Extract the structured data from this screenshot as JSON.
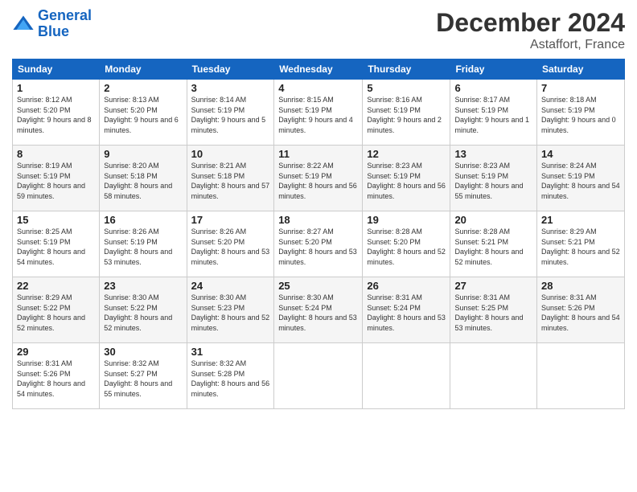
{
  "logo": {
    "line1": "General",
    "line2": "Blue"
  },
  "title": "December 2024",
  "subtitle": "Astaffort, France",
  "headers": [
    "Sunday",
    "Monday",
    "Tuesday",
    "Wednesday",
    "Thursday",
    "Friday",
    "Saturday"
  ],
  "weeks": [
    [
      {
        "day": "1",
        "sunrise": "8:12 AM",
        "sunset": "5:20 PM",
        "daylight": "9 hours and 8 minutes."
      },
      {
        "day": "2",
        "sunrise": "8:13 AM",
        "sunset": "5:20 PM",
        "daylight": "9 hours and 6 minutes."
      },
      {
        "day": "3",
        "sunrise": "8:14 AM",
        "sunset": "5:19 PM",
        "daylight": "9 hours and 5 minutes."
      },
      {
        "day": "4",
        "sunrise": "8:15 AM",
        "sunset": "5:19 PM",
        "daylight": "9 hours and 4 minutes."
      },
      {
        "day": "5",
        "sunrise": "8:16 AM",
        "sunset": "5:19 PM",
        "daylight": "9 hours and 2 minutes."
      },
      {
        "day": "6",
        "sunrise": "8:17 AM",
        "sunset": "5:19 PM",
        "daylight": "9 hours and 1 minute."
      },
      {
        "day": "7",
        "sunrise": "8:18 AM",
        "sunset": "5:19 PM",
        "daylight": "9 hours and 0 minutes."
      }
    ],
    [
      {
        "day": "8",
        "sunrise": "8:19 AM",
        "sunset": "5:19 PM",
        "daylight": "8 hours and 59 minutes."
      },
      {
        "day": "9",
        "sunrise": "8:20 AM",
        "sunset": "5:18 PM",
        "daylight": "8 hours and 58 minutes."
      },
      {
        "day": "10",
        "sunrise": "8:21 AM",
        "sunset": "5:18 PM",
        "daylight": "8 hours and 57 minutes."
      },
      {
        "day": "11",
        "sunrise": "8:22 AM",
        "sunset": "5:19 PM",
        "daylight": "8 hours and 56 minutes."
      },
      {
        "day": "12",
        "sunrise": "8:23 AM",
        "sunset": "5:19 PM",
        "daylight": "8 hours and 56 minutes."
      },
      {
        "day": "13",
        "sunrise": "8:23 AM",
        "sunset": "5:19 PM",
        "daylight": "8 hours and 55 minutes."
      },
      {
        "day": "14",
        "sunrise": "8:24 AM",
        "sunset": "5:19 PM",
        "daylight": "8 hours and 54 minutes."
      }
    ],
    [
      {
        "day": "15",
        "sunrise": "8:25 AM",
        "sunset": "5:19 PM",
        "daylight": "8 hours and 54 minutes."
      },
      {
        "day": "16",
        "sunrise": "8:26 AM",
        "sunset": "5:19 PM",
        "daylight": "8 hours and 53 minutes."
      },
      {
        "day": "17",
        "sunrise": "8:26 AM",
        "sunset": "5:20 PM",
        "daylight": "8 hours and 53 minutes."
      },
      {
        "day": "18",
        "sunrise": "8:27 AM",
        "sunset": "5:20 PM",
        "daylight": "8 hours and 53 minutes."
      },
      {
        "day": "19",
        "sunrise": "8:28 AM",
        "sunset": "5:20 PM",
        "daylight": "8 hours and 52 minutes."
      },
      {
        "day": "20",
        "sunrise": "8:28 AM",
        "sunset": "5:21 PM",
        "daylight": "8 hours and 52 minutes."
      },
      {
        "day": "21",
        "sunrise": "8:29 AM",
        "sunset": "5:21 PM",
        "daylight": "8 hours and 52 minutes."
      }
    ],
    [
      {
        "day": "22",
        "sunrise": "8:29 AM",
        "sunset": "5:22 PM",
        "daylight": "8 hours and 52 minutes."
      },
      {
        "day": "23",
        "sunrise": "8:30 AM",
        "sunset": "5:22 PM",
        "daylight": "8 hours and 52 minutes."
      },
      {
        "day": "24",
        "sunrise": "8:30 AM",
        "sunset": "5:23 PM",
        "daylight": "8 hours and 52 minutes."
      },
      {
        "day": "25",
        "sunrise": "8:30 AM",
        "sunset": "5:24 PM",
        "daylight": "8 hours and 53 minutes."
      },
      {
        "day": "26",
        "sunrise": "8:31 AM",
        "sunset": "5:24 PM",
        "daylight": "8 hours and 53 minutes."
      },
      {
        "day": "27",
        "sunrise": "8:31 AM",
        "sunset": "5:25 PM",
        "daylight": "8 hours and 53 minutes."
      },
      {
        "day": "28",
        "sunrise": "8:31 AM",
        "sunset": "5:26 PM",
        "daylight": "8 hours and 54 minutes."
      }
    ],
    [
      {
        "day": "29",
        "sunrise": "8:31 AM",
        "sunset": "5:26 PM",
        "daylight": "8 hours and 54 minutes."
      },
      {
        "day": "30",
        "sunrise": "8:32 AM",
        "sunset": "5:27 PM",
        "daylight": "8 hours and 55 minutes."
      },
      {
        "day": "31",
        "sunrise": "8:32 AM",
        "sunset": "5:28 PM",
        "daylight": "8 hours and 56 minutes."
      },
      null,
      null,
      null,
      null
    ]
  ]
}
